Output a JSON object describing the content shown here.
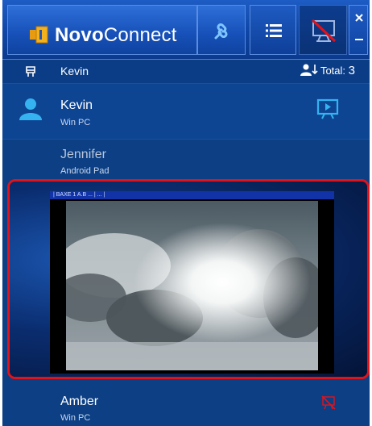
{
  "app": {
    "brand_part1": "Novo",
    "brand_part2": "Connect"
  },
  "toolbar": {
    "icons": [
      "novo-logo-icon",
      "link-icon",
      "list-icon",
      "stop-projection-icon",
      "close-icon",
      "minimize-icon"
    ]
  },
  "header": {
    "name": "Kevin",
    "total_label": "Total:",
    "total_count": "3"
  },
  "users": [
    {
      "name": "Kevin",
      "device": "Win PC"
    },
    {
      "name": "Jennifer",
      "device": "Android Pad"
    },
    {
      "name": "Amber",
      "device": "Win PC"
    }
  ],
  "preview": {
    "status_bar_text": "| BAXE 1 A.B  ...  |  ...  |"
  },
  "colors": {
    "panel": "#0c3f83",
    "toolbar": "#1650b8",
    "highlight_border": "#e0131b",
    "projecting_icon": "#34b3f0",
    "stopped_icon": "#e0131b"
  }
}
